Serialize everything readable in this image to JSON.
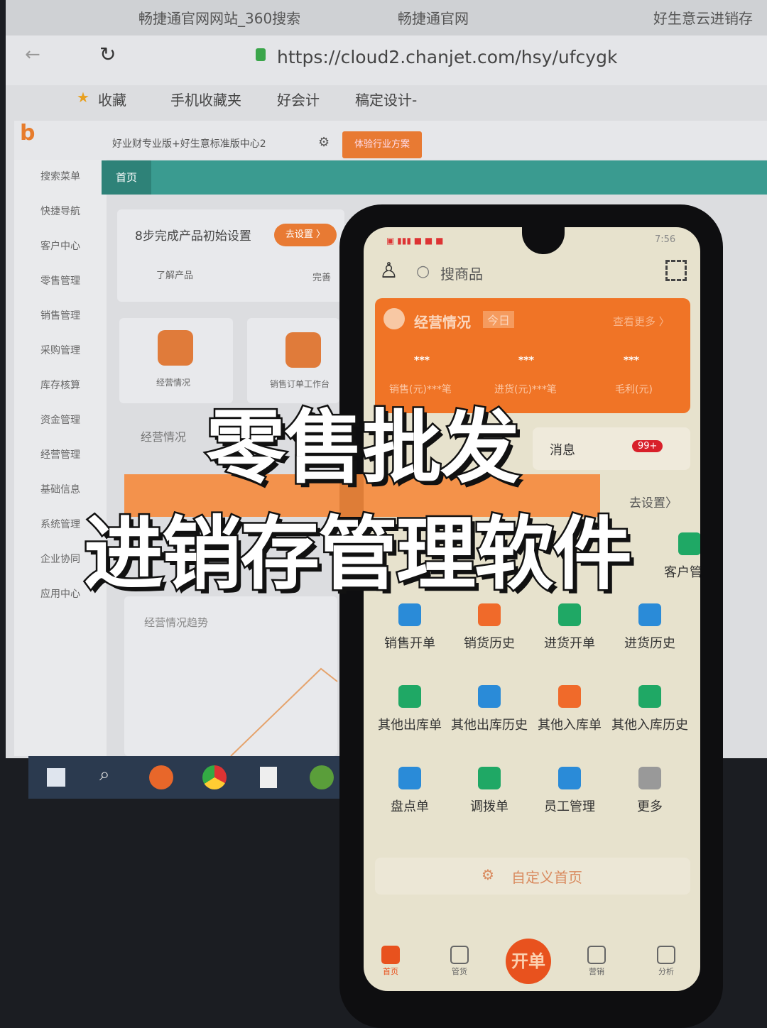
{
  "browser": {
    "tabs": [
      "畅捷通官网网站_360搜索",
      "畅捷通官网",
      "好生意云进销存"
    ],
    "url": "https://cloud2.chanjet.com/hsy/ufcygk",
    "bookmarks": [
      "收藏",
      "手机收藏夹",
      "好会计",
      "稿定设计-"
    ]
  },
  "app": {
    "product": "好业财专业版+好生意标准版中心2",
    "trial_button": "体验行业方案",
    "tab": "首页",
    "sidebar": [
      "搜索菜单",
      "快捷导航",
      "客户中心",
      "零售管理",
      "销售管理",
      "采购管理",
      "库存核算",
      "资金管理",
      "经营管理",
      "基础信息",
      "系统管理",
      "企业协同",
      "应用中心"
    ],
    "setup_title": "8步完成产品初始设置",
    "setup_button": "去设置 〉",
    "steps": [
      "了解产品",
      "完善"
    ],
    "shortcuts": [
      "经营情况",
      "销售订单工作台"
    ],
    "section": "经营情况",
    "trend": "经营情况趋势"
  },
  "phone": {
    "time": "7:56",
    "search_placeholder": "搜商品",
    "card": {
      "title": "经营情况",
      "period": "今日",
      "more": "查看更多 〉",
      "values": [
        "***",
        "***",
        "***"
      ],
      "labels": [
        "销售(元)***笔",
        "进货(元)***笔",
        "毛利(元)"
      ]
    },
    "messages": {
      "label": "消息",
      "badge": "99+"
    },
    "goto_setup": "去设置〉",
    "grid": [
      "客户管理",
      "销售开单",
      "销货历史",
      "进货开单",
      "进货历史",
      "其他出库单",
      "其他出库历史",
      "其他入库单",
      "其他入库历史",
      "盘点单",
      "调拨单",
      "员工管理",
      "更多"
    ],
    "customize": "自定义首页",
    "nav": [
      "首页",
      "管货",
      "开单",
      "营销",
      "分析"
    ]
  },
  "overlay": {
    "line1": "零售批发",
    "line2": "进销存管理软件"
  },
  "colors": {
    "accent": "#f07426",
    "teal": "#3a9b90",
    "green": "#1fa865"
  }
}
